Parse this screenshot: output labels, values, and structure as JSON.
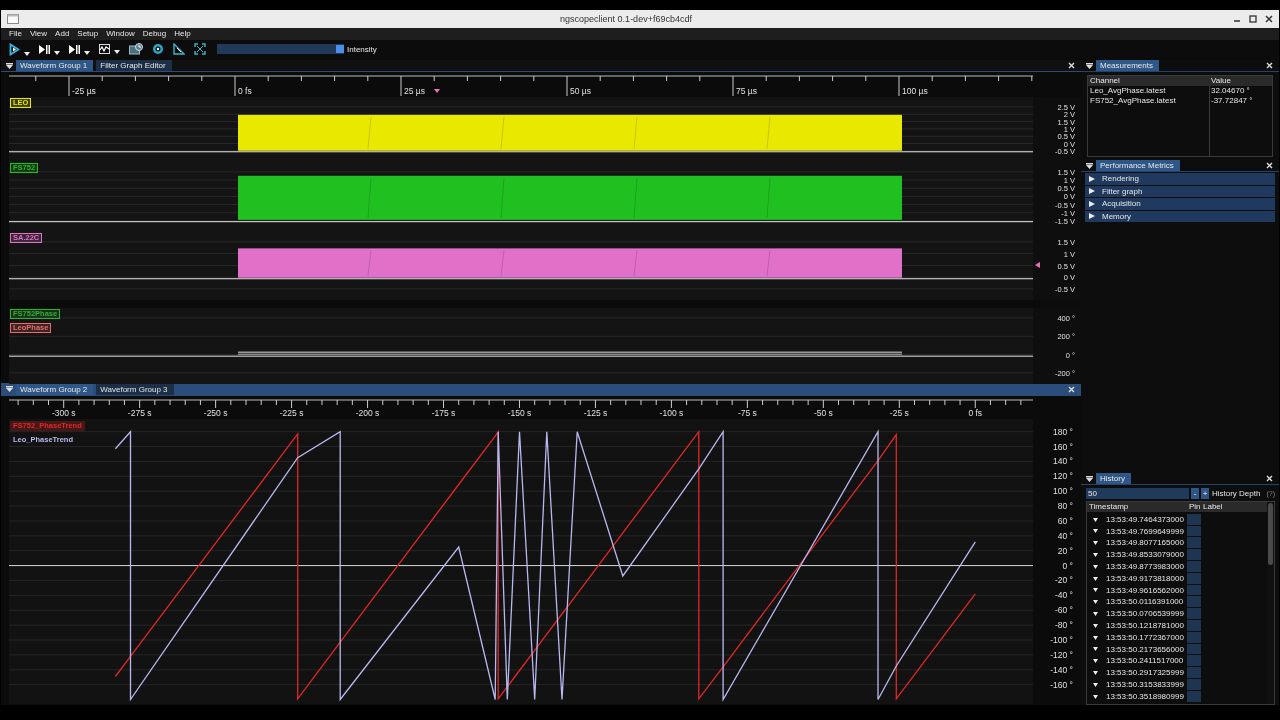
{
  "window": {
    "title": "ngscopeclient 0.1-dev+f69cb4cdf"
  },
  "menu": [
    "File",
    "View",
    "Add",
    "Setup",
    "Window",
    "Debug",
    "Help"
  ],
  "toolbar": {
    "intensity": {
      "label": "Intensity",
      "level": 1
    }
  },
  "top_group": {
    "tabs": [
      {
        "label": "Waveform Group 1",
        "selected": true
      },
      {
        "label": "Filter Graph Editor",
        "selected": false
      }
    ],
    "time_axis": [
      "-25 µs",
      "0 fs",
      "25 µs",
      "50 µs",
      "75 µs",
      "100 µs"
    ],
    "channels": [
      {
        "kind": "band",
        "trigger_arrow": false,
        "labels": [
          {
            "name": "LEO",
            "color": "#e8e800"
          }
        ],
        "y_labels": [
          "2.5 V",
          "2 V",
          "1.5 V",
          "1 V",
          "0.5 V",
          "0 V",
          "-0.5 V"
        ]
      },
      {
        "kind": "band",
        "trigger_arrow": false,
        "labels": [
          {
            "name": "FS752",
            "color": "#20c020"
          }
        ],
        "y_labels": [
          "1.5 V",
          "1 V",
          "0.5 V",
          "0 V",
          "-0.5 V",
          "-1 V",
          "-1.5 V"
        ]
      },
      {
        "kind": "band",
        "trigger_arrow": true,
        "labels": [
          {
            "name": "SA.22C",
            "color": "#e070c8"
          }
        ],
        "y_labels": [
          "1.5 V",
          "1 V",
          "0.5 V",
          "0 V",
          "-0.5 V"
        ]
      },
      {
        "kind": "lines",
        "trigger_arrow": false,
        "labels": [
          {
            "name": "FS752Phase",
            "color": "#30b030"
          },
          {
            "name": "LeoPhase",
            "color": "#e86a6a"
          }
        ],
        "y_labels": [
          "400 °",
          "200 °",
          "0 °",
          "-200 °"
        ]
      }
    ]
  },
  "bottom_group": {
    "tabs": [
      {
        "label": "Waveform Group 2",
        "selected": true
      },
      {
        "label": "Waveform Group 3",
        "selected": false
      }
    ],
    "chart_data": {
      "type": "line",
      "grid": true,
      "x": [
        -283,
        -278,
        -278,
        -223,
        -223,
        -209,
        -209,
        -170,
        -158,
        -157,
        -157,
        -154,
        -150,
        -145,
        -141,
        -136,
        -131,
        -116,
        -91,
        -91,
        -83,
        -83,
        -32,
        -32,
        -26,
        -26,
        0
      ],
      "series": [
        {
          "name": "FS752_PhaseTrend",
          "color": "#e02828",
          "values": [
            -149,
            -122,
            -122,
            177,
            -179,
            -103,
            -103,
            109,
            174,
            180,
            -179,
            -163,
            -141,
            -114,
            -92,
            -65,
            -38,
            44,
            180,
            -179,
            -136,
            -136,
            141,
            141,
            176,
            -179,
            -38
          ]
        },
        {
          "name": "Leo_PhaseTrend",
          "color": "#b8b8f0",
          "values": [
            157,
            180,
            -180,
            145,
            145,
            180,
            -180,
            25,
            -180,
            180,
            180,
            -180,
            180,
            -180,
            180,
            -180,
            180,
            -14,
            130,
            130,
            180,
            -180,
            180,
            -180,
            -135,
            -135,
            32
          ]
        }
      ],
      "xlim": [
        -318,
        19
      ],
      "ylim": [
        -186,
        197
      ],
      "xticks": [
        {
          "value": -300,
          "label": "-300 s"
        },
        {
          "value": -275,
          "label": "-275 s"
        },
        {
          "value": -250,
          "label": "-250 s"
        },
        {
          "value": -225,
          "label": "-225 s"
        },
        {
          "value": -200,
          "label": "-200 s"
        },
        {
          "value": -175,
          "label": "-175 s"
        },
        {
          "value": -150,
          "label": "-150 s"
        },
        {
          "value": -125,
          "label": "-125 s"
        },
        {
          "value": -100,
          "label": "-100 s"
        },
        {
          "value": -75,
          "label": "-75 s"
        },
        {
          "value": -50,
          "label": "-50 s"
        },
        {
          "value": -25,
          "label": "-25 s"
        },
        {
          "value": 0,
          "label": "0 fs"
        }
      ],
      "yticks": [
        {
          "value": 180,
          "label": "180 °"
        },
        {
          "value": 160,
          "label": "160 °"
        },
        {
          "value": 140,
          "label": "140 °"
        },
        {
          "value": 120,
          "label": "120 °"
        },
        {
          "value": 100,
          "label": "100 °"
        },
        {
          "value": 80,
          "label": "80 °"
        },
        {
          "value": 60,
          "label": "60 °"
        },
        {
          "value": 40,
          "label": "40 °"
        },
        {
          "value": 20,
          "label": "20 °"
        },
        {
          "value": 0,
          "label": "0 °"
        },
        {
          "value": -20,
          "label": "-20 °"
        },
        {
          "value": -40,
          "label": "-40 °"
        },
        {
          "value": -60,
          "label": "-60 °"
        },
        {
          "value": -80,
          "label": "-80 °"
        },
        {
          "value": -100,
          "label": "-100 °"
        },
        {
          "value": -120,
          "label": "-120 °"
        },
        {
          "value": -140,
          "label": "-140 °"
        },
        {
          "value": -160,
          "label": "-160 °"
        }
      ]
    }
  },
  "measurements": {
    "title": "Measurements",
    "columns": [
      "Channel",
      "Value"
    ],
    "rows": [
      [
        "Leo_AvgPhase.latest",
        "32.04670 °"
      ],
      [
        "FS752_AvgPhase.latest",
        "-37.72847 °"
      ]
    ]
  },
  "performance": {
    "title": "Performance Metrics",
    "items": [
      {
        "label": "Rendering",
        "expanded": false
      },
      {
        "label": "Filter graph",
        "expanded": false
      },
      {
        "label": "Acquisition",
        "expanded": false
      },
      {
        "label": "Memory",
        "expanded": false
      }
    ]
  },
  "history": {
    "title": "History",
    "depth": "50",
    "minus": "-",
    "plus": "+",
    "depth_label": "History Depth",
    "help": "(?)",
    "columns": [
      "Timestamp",
      "Pin",
      "Label"
    ],
    "rows": [
      "13:53:49.7464373000",
      "13:53:49.7699649999",
      "13:53:49.8077165000",
      "13:53:49.8533079000",
      "13:53:49.8773983000",
      "13:53:49.9173818000",
      "13:53:49.9616562000",
      "13:53:50.0116391000",
      "13:53:50.0706539999",
      "13:53:50.1218781000",
      "13:53:50.1772367000",
      "13:53:50.2173656000",
      "13:53:50.2411517000",
      "13:53:50.2917325999",
      "13:53:50.3153833999",
      "13:53:50.3518980999"
    ]
  }
}
